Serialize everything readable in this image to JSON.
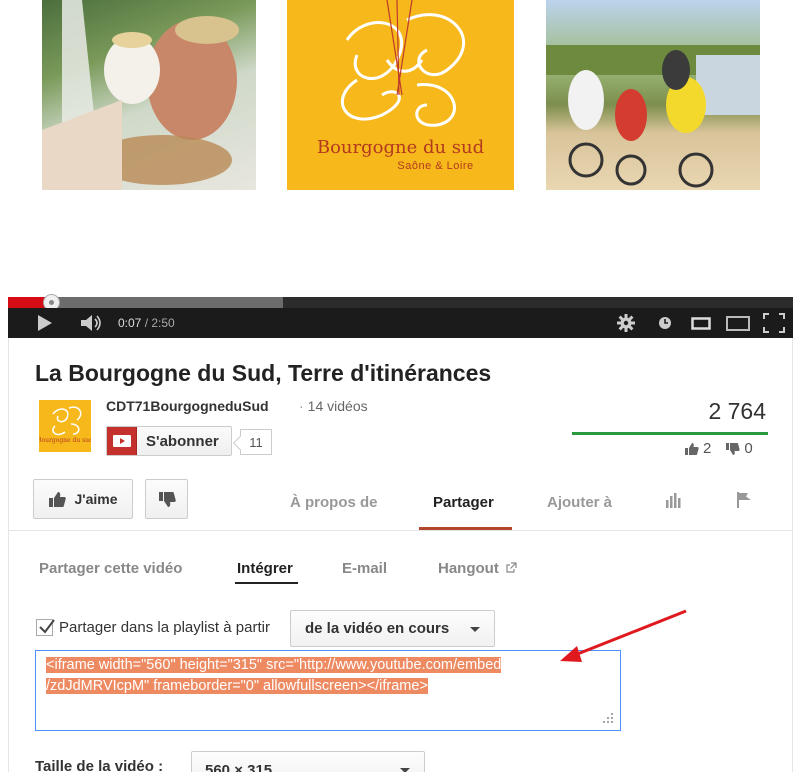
{
  "video": {
    "poster_logo_title": "Bourgogne du sud",
    "poster_logo_subtitle": "Saône & Loire"
  },
  "player": {
    "current_time": "0:07",
    "duration": "2:50",
    "progress_fraction": 0.041,
    "buffered_fraction": 0.35,
    "colors": {
      "played": "#d50b16",
      "bar": "#1b1b1b"
    },
    "icons": [
      "play-icon",
      "volume-icon",
      "settings-icon",
      "quality-icon",
      "small-player-icon",
      "large-player-icon",
      "fullscreen-icon"
    ]
  },
  "info": {
    "title": "La Bourgogne du Sud, Terre d'itinérances",
    "channel_name": "CDT71BourgogneduSud",
    "channel_video_count": "14 vidéos",
    "subscribe_label": "S'abonner",
    "subscriber_count": "11",
    "view_count": "2 764",
    "likes": "2",
    "dislikes": "0"
  },
  "actions": {
    "like_label": "J'aime",
    "tabs": {
      "about": "À propos de",
      "share": "Partager",
      "add_to": "Ajouter à"
    }
  },
  "share": {
    "subtabs": {
      "share_video": "Partager cette vidéo",
      "embed": "Intégrer",
      "email": "E-mail",
      "hangout": "Hangout"
    },
    "playlist_checkbox_label": "Partager dans la playlist à partir",
    "playlist_checked": true,
    "playlist_select_value": "de la vidéo en cours",
    "embed_code_line1": "<iframe width=\"560\" height=\"315\" src=\"http://www.youtube.com/embed",
    "embed_code_line2": "/zdJdMRVIcpM\" frameborder=\"0\" allowfullscreen></iframe>",
    "size_label": "Taille de la vidéo :",
    "size_select_value": "560 × 315",
    "highlight_color": "#ee8a62",
    "annotation_arrow_color": "#e0191f"
  }
}
